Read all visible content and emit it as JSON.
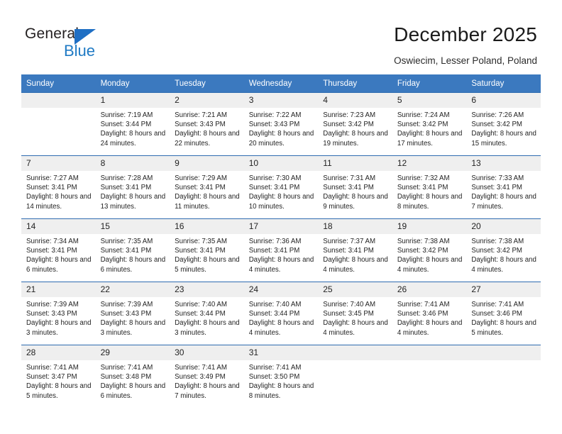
{
  "brand": {
    "name_top": "General",
    "name_bottom": "Blue",
    "accent_color": "#1f7ac4",
    "header_color": "#3b79bf"
  },
  "header": {
    "title": "December 2025",
    "subtitle": "Oswiecim, Lesser Poland, Poland"
  },
  "calendar": {
    "weekdays": [
      "Sunday",
      "Monday",
      "Tuesday",
      "Wednesday",
      "Thursday",
      "Friday",
      "Saturday"
    ],
    "weeks": [
      [
        {
          "day": "",
          "sunrise": "",
          "sunset": "",
          "daylight": ""
        },
        {
          "day": "1",
          "sunrise": "Sunrise: 7:19 AM",
          "sunset": "Sunset: 3:44 PM",
          "daylight": "Daylight: 8 hours and 24 minutes."
        },
        {
          "day": "2",
          "sunrise": "Sunrise: 7:21 AM",
          "sunset": "Sunset: 3:43 PM",
          "daylight": "Daylight: 8 hours and 22 minutes."
        },
        {
          "day": "3",
          "sunrise": "Sunrise: 7:22 AM",
          "sunset": "Sunset: 3:43 PM",
          "daylight": "Daylight: 8 hours and 20 minutes."
        },
        {
          "day": "4",
          "sunrise": "Sunrise: 7:23 AM",
          "sunset": "Sunset: 3:42 PM",
          "daylight": "Daylight: 8 hours and 19 minutes."
        },
        {
          "day": "5",
          "sunrise": "Sunrise: 7:24 AM",
          "sunset": "Sunset: 3:42 PM",
          "daylight": "Daylight: 8 hours and 17 minutes."
        },
        {
          "day": "6",
          "sunrise": "Sunrise: 7:26 AM",
          "sunset": "Sunset: 3:42 PM",
          "daylight": "Daylight: 8 hours and 15 minutes."
        }
      ],
      [
        {
          "day": "7",
          "sunrise": "Sunrise: 7:27 AM",
          "sunset": "Sunset: 3:41 PM",
          "daylight": "Daylight: 8 hours and 14 minutes."
        },
        {
          "day": "8",
          "sunrise": "Sunrise: 7:28 AM",
          "sunset": "Sunset: 3:41 PM",
          "daylight": "Daylight: 8 hours and 13 minutes."
        },
        {
          "day": "9",
          "sunrise": "Sunrise: 7:29 AM",
          "sunset": "Sunset: 3:41 PM",
          "daylight": "Daylight: 8 hours and 11 minutes."
        },
        {
          "day": "10",
          "sunrise": "Sunrise: 7:30 AM",
          "sunset": "Sunset: 3:41 PM",
          "daylight": "Daylight: 8 hours and 10 minutes."
        },
        {
          "day": "11",
          "sunrise": "Sunrise: 7:31 AM",
          "sunset": "Sunset: 3:41 PM",
          "daylight": "Daylight: 8 hours and 9 minutes."
        },
        {
          "day": "12",
          "sunrise": "Sunrise: 7:32 AM",
          "sunset": "Sunset: 3:41 PM",
          "daylight": "Daylight: 8 hours and 8 minutes."
        },
        {
          "day": "13",
          "sunrise": "Sunrise: 7:33 AM",
          "sunset": "Sunset: 3:41 PM",
          "daylight": "Daylight: 8 hours and 7 minutes."
        }
      ],
      [
        {
          "day": "14",
          "sunrise": "Sunrise: 7:34 AM",
          "sunset": "Sunset: 3:41 PM",
          "daylight": "Daylight: 8 hours and 6 minutes."
        },
        {
          "day": "15",
          "sunrise": "Sunrise: 7:35 AM",
          "sunset": "Sunset: 3:41 PM",
          "daylight": "Daylight: 8 hours and 6 minutes."
        },
        {
          "day": "16",
          "sunrise": "Sunrise: 7:35 AM",
          "sunset": "Sunset: 3:41 PM",
          "daylight": "Daylight: 8 hours and 5 minutes."
        },
        {
          "day": "17",
          "sunrise": "Sunrise: 7:36 AM",
          "sunset": "Sunset: 3:41 PM",
          "daylight": "Daylight: 8 hours and 4 minutes."
        },
        {
          "day": "18",
          "sunrise": "Sunrise: 7:37 AM",
          "sunset": "Sunset: 3:41 PM",
          "daylight": "Daylight: 8 hours and 4 minutes."
        },
        {
          "day": "19",
          "sunrise": "Sunrise: 7:38 AM",
          "sunset": "Sunset: 3:42 PM",
          "daylight": "Daylight: 8 hours and 4 minutes."
        },
        {
          "day": "20",
          "sunrise": "Sunrise: 7:38 AM",
          "sunset": "Sunset: 3:42 PM",
          "daylight": "Daylight: 8 hours and 4 minutes."
        }
      ],
      [
        {
          "day": "21",
          "sunrise": "Sunrise: 7:39 AM",
          "sunset": "Sunset: 3:43 PM",
          "daylight": "Daylight: 8 hours and 3 minutes."
        },
        {
          "day": "22",
          "sunrise": "Sunrise: 7:39 AM",
          "sunset": "Sunset: 3:43 PM",
          "daylight": "Daylight: 8 hours and 3 minutes."
        },
        {
          "day": "23",
          "sunrise": "Sunrise: 7:40 AM",
          "sunset": "Sunset: 3:44 PM",
          "daylight": "Daylight: 8 hours and 3 minutes."
        },
        {
          "day": "24",
          "sunrise": "Sunrise: 7:40 AM",
          "sunset": "Sunset: 3:44 PM",
          "daylight": "Daylight: 8 hours and 4 minutes."
        },
        {
          "day": "25",
          "sunrise": "Sunrise: 7:40 AM",
          "sunset": "Sunset: 3:45 PM",
          "daylight": "Daylight: 8 hours and 4 minutes."
        },
        {
          "day": "26",
          "sunrise": "Sunrise: 7:41 AM",
          "sunset": "Sunset: 3:46 PM",
          "daylight": "Daylight: 8 hours and 4 minutes."
        },
        {
          "day": "27",
          "sunrise": "Sunrise: 7:41 AM",
          "sunset": "Sunset: 3:46 PM",
          "daylight": "Daylight: 8 hours and 5 minutes."
        }
      ],
      [
        {
          "day": "28",
          "sunrise": "Sunrise: 7:41 AM",
          "sunset": "Sunset: 3:47 PM",
          "daylight": "Daylight: 8 hours and 5 minutes."
        },
        {
          "day": "29",
          "sunrise": "Sunrise: 7:41 AM",
          "sunset": "Sunset: 3:48 PM",
          "daylight": "Daylight: 8 hours and 6 minutes."
        },
        {
          "day": "30",
          "sunrise": "Sunrise: 7:41 AM",
          "sunset": "Sunset: 3:49 PM",
          "daylight": "Daylight: 8 hours and 7 minutes."
        },
        {
          "day": "31",
          "sunrise": "Sunrise: 7:41 AM",
          "sunset": "Sunset: 3:50 PM",
          "daylight": "Daylight: 8 hours and 8 minutes."
        },
        {
          "day": "",
          "sunrise": "",
          "sunset": "",
          "daylight": ""
        },
        {
          "day": "",
          "sunrise": "",
          "sunset": "",
          "daylight": ""
        },
        {
          "day": "",
          "sunrise": "",
          "sunset": "",
          "daylight": ""
        }
      ]
    ]
  }
}
